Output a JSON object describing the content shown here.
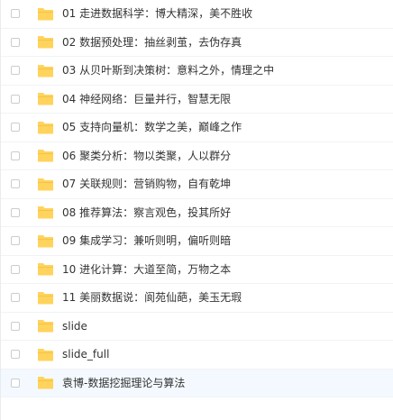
{
  "files": [
    {
      "name": "01 走进数据科学：博大精深，美不胜收"
    },
    {
      "name": "02 数据预处理：抽丝剥茧，去伪存真"
    },
    {
      "name": "03 从贝叶斯到决策树：意料之外，情理之中"
    },
    {
      "name": "04 神经网络：巨量并行，智慧无限"
    },
    {
      "name": "05 支持向量机：数学之美，巅峰之作"
    },
    {
      "name": "06 聚类分析：物以类聚，人以群分"
    },
    {
      "name": "07 关联规则：营销购物，自有乾坤"
    },
    {
      "name": "08 推荐算法：察言观色，投其所好"
    },
    {
      "name": "09 集成学习：兼听则明，偏听则暗"
    },
    {
      "name": "10 进化计算：大道至简，万物之本"
    },
    {
      "name": "11 美丽数据说：阆苑仙葩，美玉无瑕"
    },
    {
      "name": "slide"
    },
    {
      "name": "slide_full"
    },
    {
      "name": "袁博-数据挖掘理论与算法"
    }
  ],
  "icons": {
    "folder": "folder-icon"
  },
  "colors": {
    "folder": "#ffd35c",
    "highlight_row": "#f3f9fe"
  }
}
